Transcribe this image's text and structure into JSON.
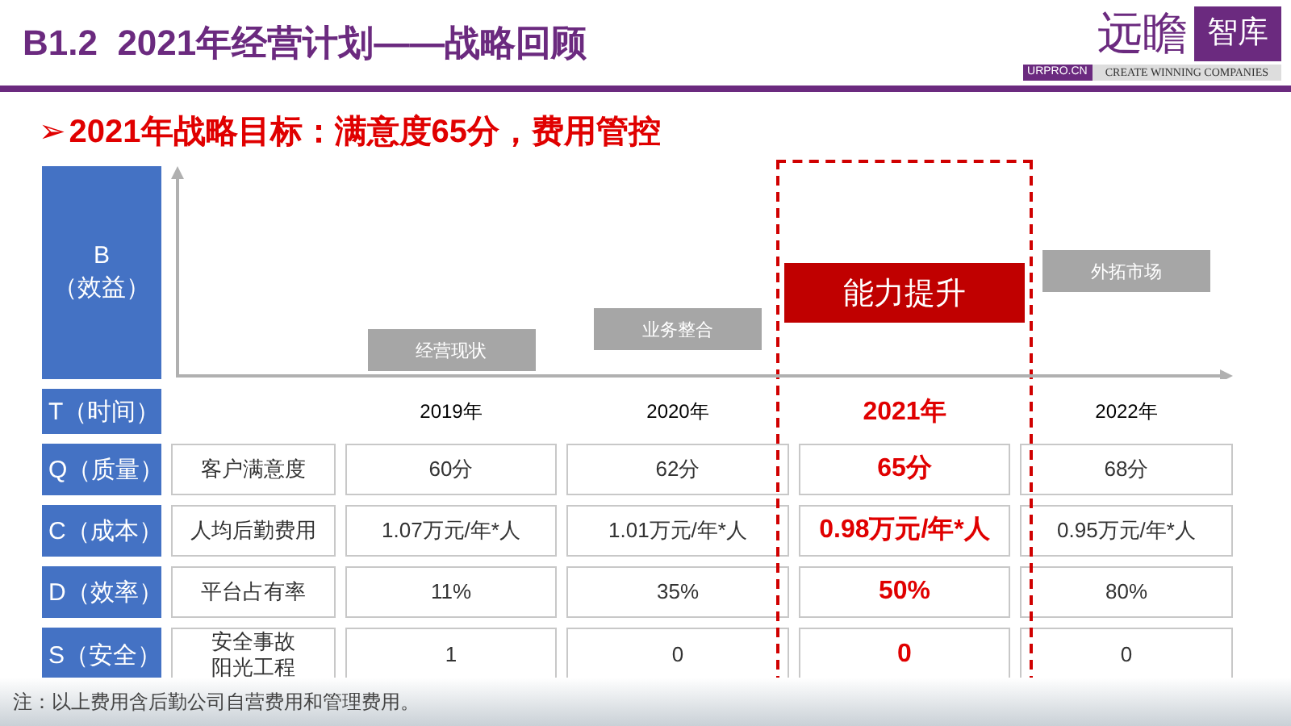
{
  "header": {
    "title": "B1.2  2021年经营计划——战略回顾",
    "logo": {
      "brand": "远瞻",
      "tag": "智库",
      "site": "URPRO.CN",
      "slogan": "CREATE WINNING COMPANIES"
    }
  },
  "subtitle": {
    "bullet": "➢",
    "text": "2021年战略目标：满意度65分，费用管控"
  },
  "benefit_label": [
    "B",
    "（效益）"
  ],
  "stages": [
    {
      "label": "经营现状",
      "kind": "normal"
    },
    {
      "label": "业务整合",
      "kind": "normal"
    },
    {
      "label": "能力提升",
      "kind": "highlight"
    },
    {
      "label": "外拓市场",
      "kind": "normal"
    }
  ],
  "time_label": "T（时间）",
  "years": [
    {
      "label": "2019年",
      "highlight": false
    },
    {
      "label": "2020年",
      "highlight": false
    },
    {
      "label": "2021年",
      "highlight": true
    },
    {
      "label": "2022年",
      "highlight": false
    }
  ],
  "rows": [
    {
      "label": "Q（质量）",
      "metric": [
        "客户满意度"
      ],
      "values": [
        "60分",
        "62分",
        "65分",
        "68分"
      ]
    },
    {
      "label": "C（成本）",
      "metric": [
        "人均后勤费用"
      ],
      "values": [
        "1.07万元/年*人",
        "1.01万元/年*人",
        "0.98万元/年*人",
        "0.95万元/年*人"
      ]
    },
    {
      "label": "D（效率）",
      "metric": [
        "平台占有率"
      ],
      "values": [
        "11%",
        "35%",
        "50%",
        "80%"
      ]
    },
    {
      "label": "S（安全）",
      "metric": [
        "安全事故",
        "阳光工程"
      ],
      "values": [
        "1",
        "0",
        "0",
        "0"
      ]
    }
  ],
  "note": "注：以上费用含后勤公司自营费用和管理费用。"
}
